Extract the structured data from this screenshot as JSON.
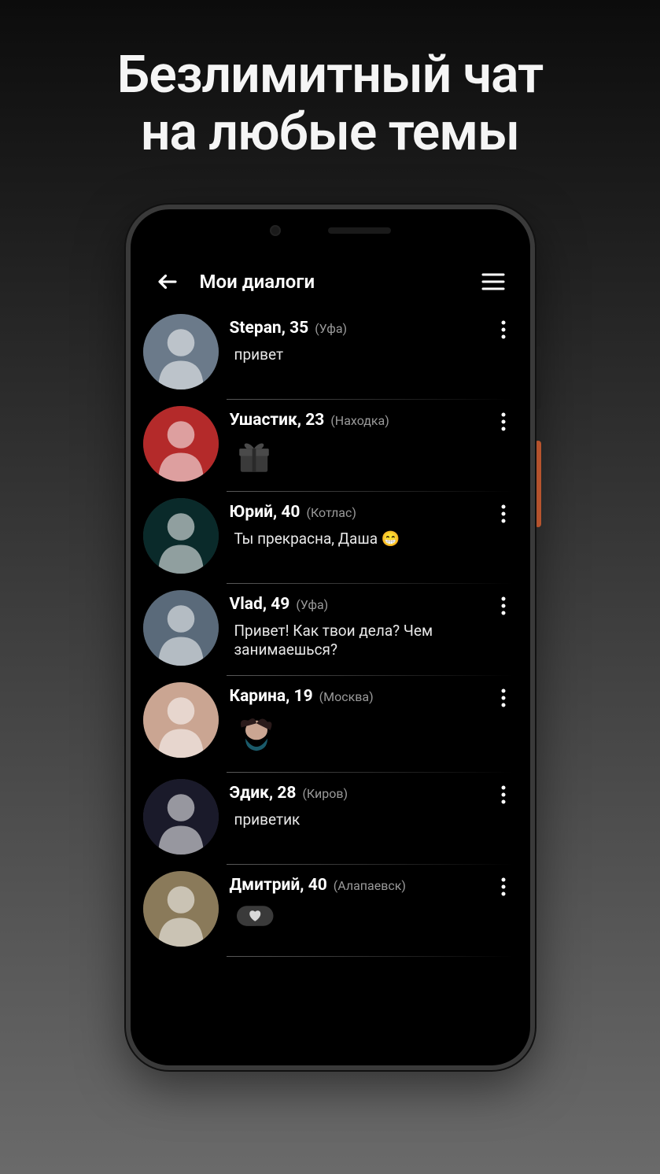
{
  "promo": {
    "line1": "Безлимитный чат",
    "line2": "на любые темы"
  },
  "header": {
    "title": "Мои диалоги"
  },
  "dialogs": [
    {
      "name": "Stepan",
      "age": "35",
      "city": "Уфа",
      "message": "привет",
      "attachment": "none",
      "avatar_bg": "#6b7a8a"
    },
    {
      "name": "Ушастик",
      "age": "23",
      "city": "Находка",
      "message": "",
      "attachment": "gift",
      "avatar_bg": "#b42a2a"
    },
    {
      "name": "Юрий",
      "age": "40",
      "city": "Котлас",
      "message": "Ты прекрасна, Даша 😁",
      "attachment": "none",
      "avatar_bg": "#0a2a2a"
    },
    {
      "name": "Vlad",
      "age": "49",
      "city": "Уфа",
      "message": "Привет! Как твои дела? Чем занимаешься?",
      "attachment": "none",
      "avatar_bg": "#5a6a7a"
    },
    {
      "name": "Карина",
      "age": "19",
      "city": "Москва",
      "message": "",
      "attachment": "sticker",
      "avatar_bg": "#caa592"
    },
    {
      "name": "Эдик",
      "age": "28",
      "city": "Киров",
      "message": "приветик",
      "attachment": "none",
      "avatar_bg": "#1a1a2a"
    },
    {
      "name": "Дмитрий",
      "age": "40",
      "city": "Алапаевск",
      "message": "",
      "attachment": "heart",
      "avatar_bg": "#8a7a5a"
    }
  ]
}
